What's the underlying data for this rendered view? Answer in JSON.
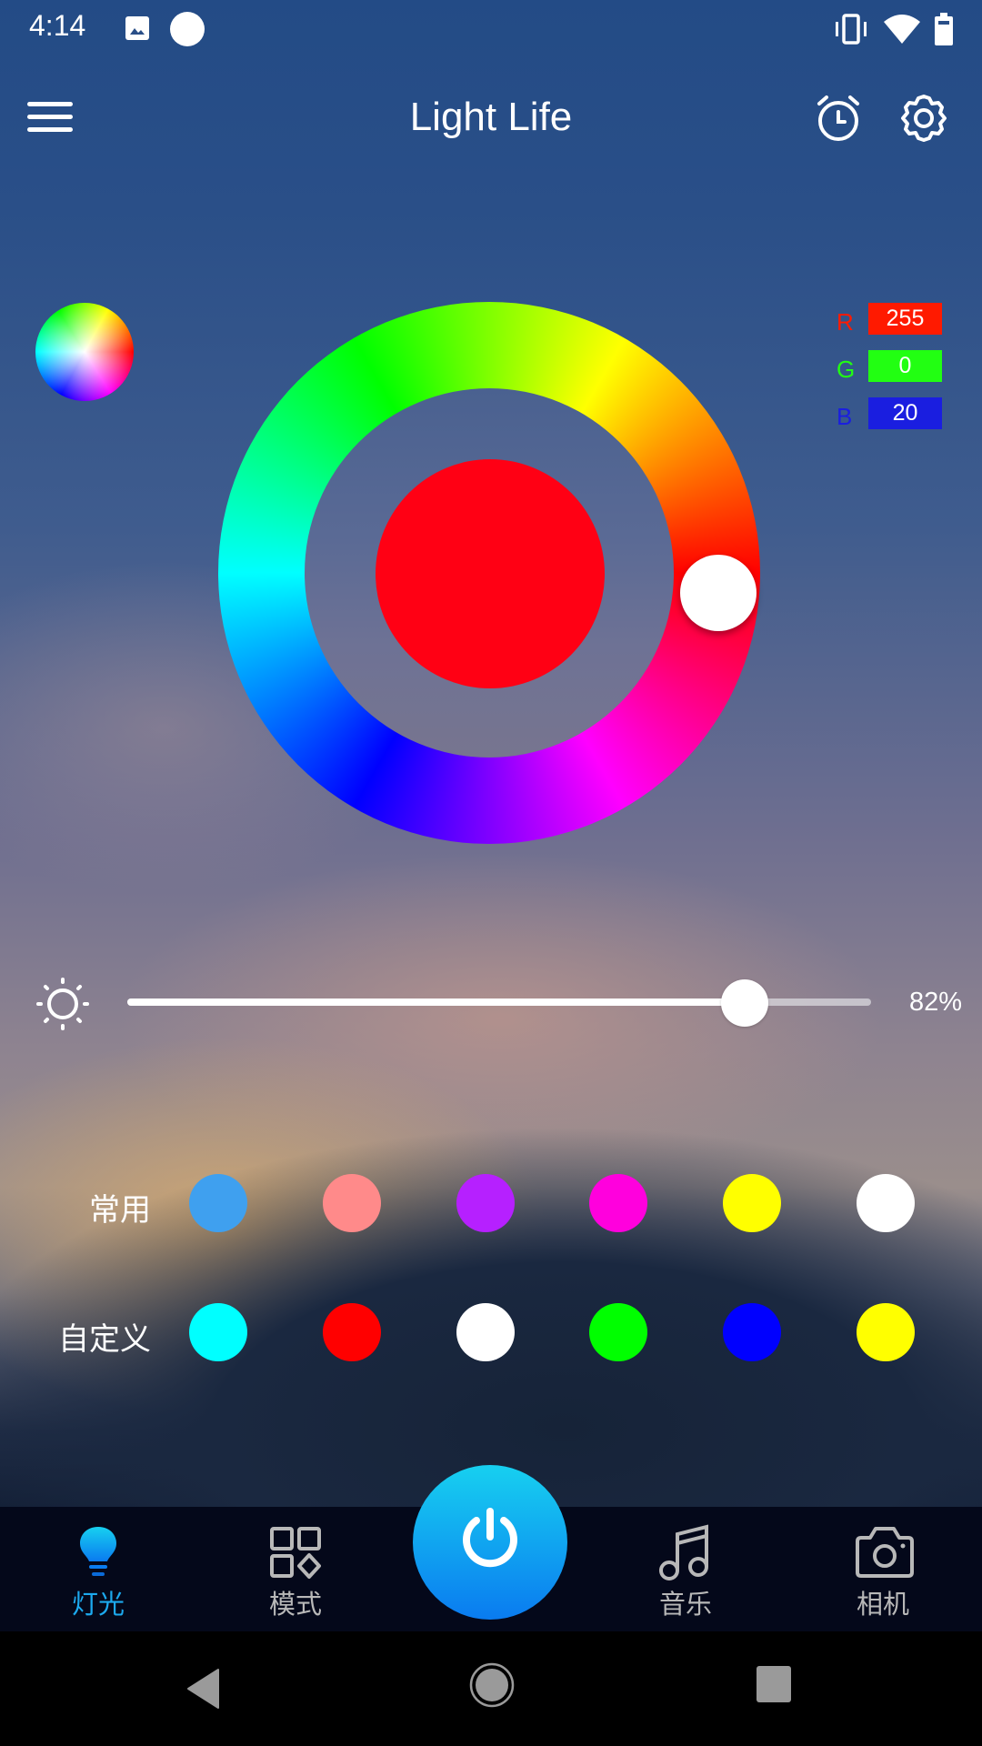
{
  "status_bar": {
    "time": "4:14",
    "left_icons": [
      "image-icon",
      "circle-notification-icon"
    ],
    "right_icons": [
      "vibrate-icon",
      "wifi-icon",
      "battery-icon"
    ]
  },
  "header": {
    "title": "Light Life",
    "menu_icon": "hamburger-menu-icon",
    "alarm_icon": "alarm-clock-icon",
    "settings_icon": "gear-icon"
  },
  "color_picker": {
    "selected_color": "#ff0014",
    "wheel_thumb_hue_deg": 356,
    "rgb": {
      "r_label": "R",
      "r_value": "255",
      "r_color": "#ff1a00",
      "g_label": "G",
      "g_value": "0",
      "g_color": "#22ff12",
      "b_label": "B",
      "b_value": "20",
      "b_color": "#1a1ee0"
    }
  },
  "brightness": {
    "value_percent": 82,
    "label": "82%"
  },
  "swatches": {
    "common": {
      "label": "常用",
      "colors": [
        "#3fa0ef",
        "#ff8a8a",
        "#b620ff",
        "#ff00dd",
        "#ffff00",
        "#ffffff"
      ]
    },
    "custom": {
      "label": "自定义",
      "colors": [
        "#00ffff",
        "#ff0000",
        "#ffffff",
        "#00ff00",
        "#0000ff",
        "#ffff00"
      ]
    }
  },
  "tabs": [
    {
      "label": "灯光",
      "icon": "bulb-icon",
      "active": true
    },
    {
      "label": "模式",
      "icon": "modes-grid-icon",
      "active": false
    },
    {
      "label": "音乐",
      "icon": "music-note-icon",
      "active": false
    },
    {
      "label": "相机",
      "icon": "camera-icon",
      "active": false
    }
  ],
  "power_button": {
    "icon": "power-icon"
  },
  "nav": {
    "back": "back-icon",
    "home": "home-icon",
    "recents": "recents-icon"
  }
}
